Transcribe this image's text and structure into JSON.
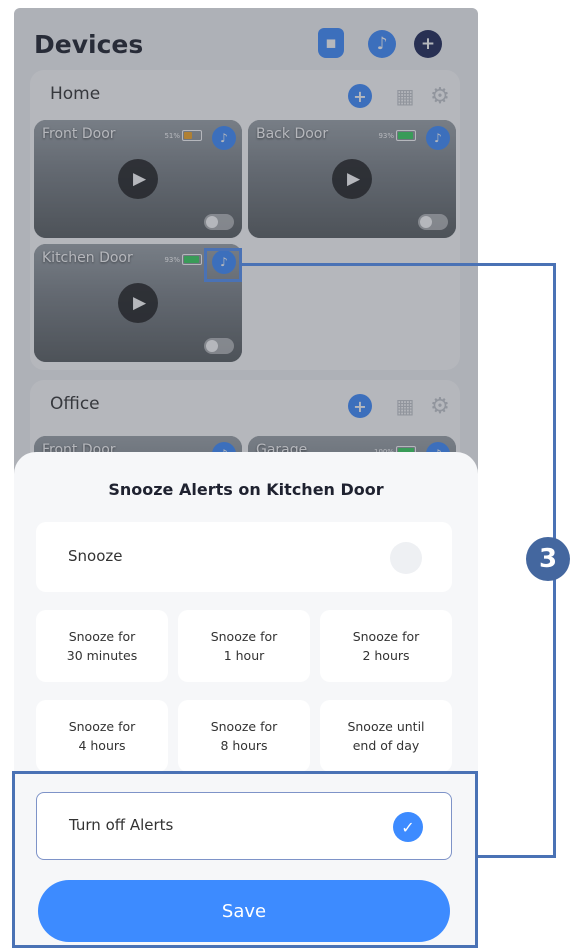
{
  "header": {
    "title": "Devices"
  },
  "groups": {
    "home": {
      "name": "Home",
      "cameras": [
        {
          "name": "Front Door",
          "battery": "51%",
          "battery_color": "#f5a623"
        },
        {
          "name": "Back Door",
          "battery": "93%",
          "battery_color": "#37d25e"
        },
        {
          "name": "Kitchen Door",
          "battery": "93%",
          "battery_color": "#37d25e"
        }
      ]
    },
    "office": {
      "name": "Office",
      "cameras": [
        {
          "name": "Front Door"
        },
        {
          "name": "Garage",
          "battery": "100%"
        }
      ]
    }
  },
  "sheet": {
    "title": "Snooze Alerts on Kitchen Door",
    "snooze_label": "Snooze",
    "options": [
      "Snooze for\n30 minutes",
      "Snooze for\n1 hour",
      "Snooze for\n2 hours",
      "Snooze for\n4 hours",
      "Snooze for\n8 hours",
      "Snooze until\nend of day"
    ],
    "turn_off_label": "Turn off Alerts",
    "save_label": "Save"
  },
  "annotation": {
    "callout_number": "3"
  },
  "colors": {
    "accent": "#3d8bff",
    "navy": "#1c2656",
    "highlight": "#4a72b5"
  }
}
